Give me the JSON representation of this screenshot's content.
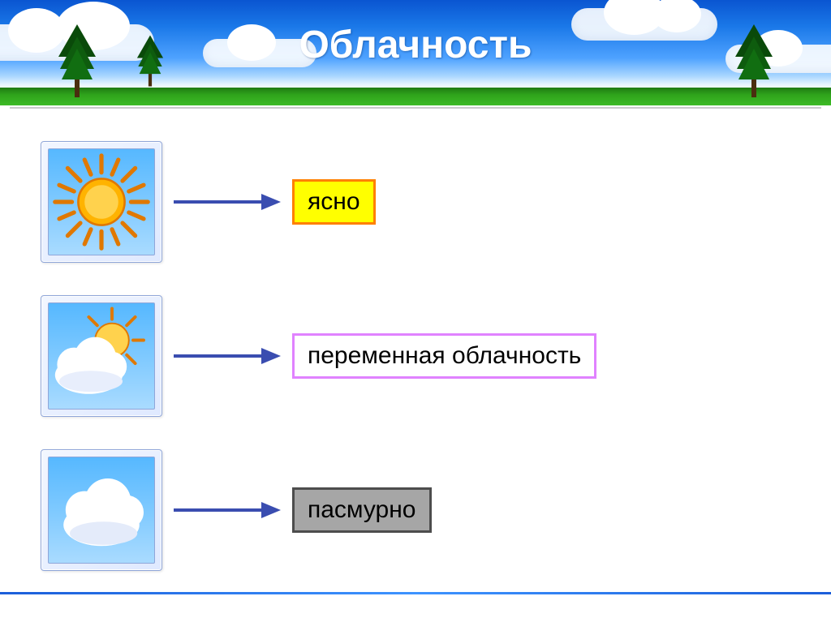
{
  "title": "Облачность",
  "rows": [
    {
      "key": "clear",
      "label": "ясно",
      "icon": "sun-icon",
      "style": "yellow"
    },
    {
      "key": "partly",
      "label": "переменная облачность",
      "icon": "partly-cloudy-icon",
      "style": "violet"
    },
    {
      "key": "overcast",
      "label": "пасмурно",
      "icon": "cloud-icon",
      "style": "gray"
    }
  ],
  "colors": {
    "arrow": "#3a4db0",
    "sky_top": "#0a55d1",
    "sky_bottom": "#a8d6ff"
  },
  "chart_data": {
    "type": "table",
    "title": "Облачность",
    "rows": [
      {
        "icon": "sun",
        "condition": "ясно"
      },
      {
        "icon": "partly-cloudy",
        "condition": "переменная облачность"
      },
      {
        "icon": "cloud",
        "condition": "пасмурно"
      }
    ]
  }
}
